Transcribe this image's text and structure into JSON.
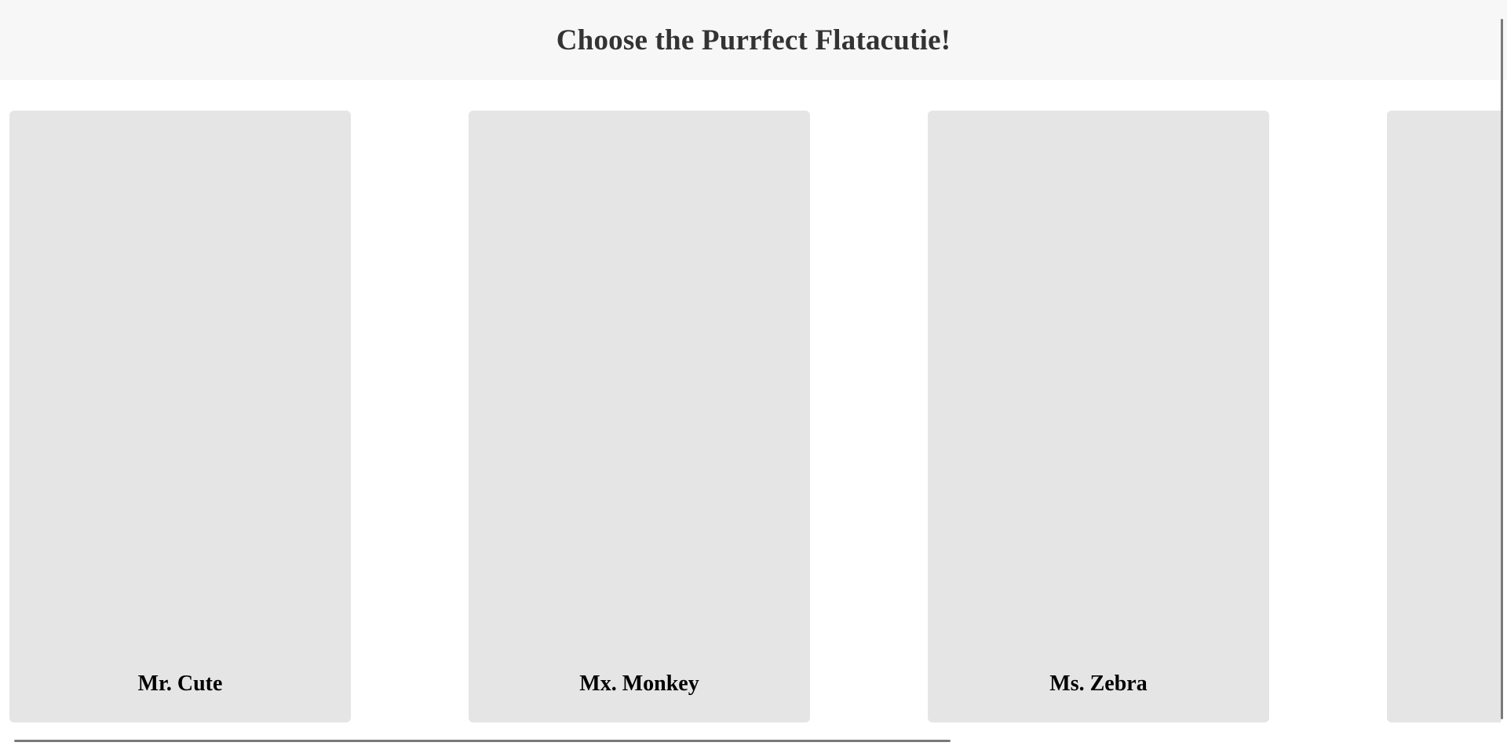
{
  "header": {
    "title": "Choose the Purrfect Flatacutie!"
  },
  "cards": [
    {
      "name": "Mr. Cute"
    },
    {
      "name": "Mx. Monkey"
    },
    {
      "name": "Ms. Zebra"
    },
    {
      "name": ""
    }
  ],
  "colors": {
    "header_background": "#f7f7f7",
    "card_background": "#e5e5e5",
    "title_text": "#333333",
    "scrollbar": "#7a7a7a"
  }
}
